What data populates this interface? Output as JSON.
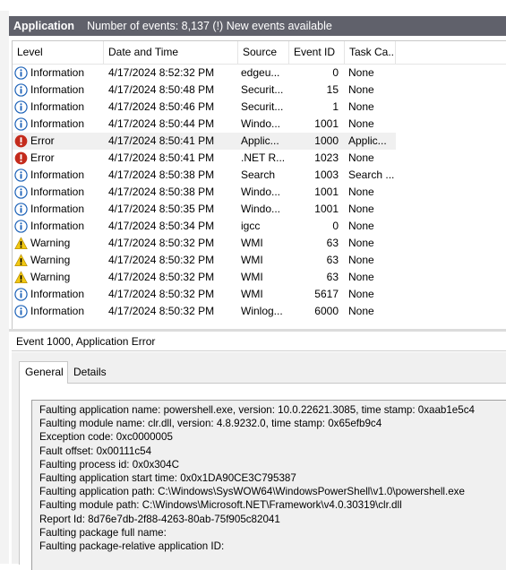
{
  "header": {
    "log_name": "Application",
    "info": "Number of events: 8,137 (!) New events available"
  },
  "columns": [
    "Level",
    "Date and Time",
    "Source",
    "Event ID",
    "Task Ca..."
  ],
  "events": [
    {
      "level": "Information",
      "icon": "info-icon",
      "date": "4/17/2024 8:52:32 PM",
      "source": "edgeu...",
      "event_id": "0",
      "task": "None"
    },
    {
      "level": "Information",
      "icon": "info-icon",
      "date": "4/17/2024 8:50:48 PM",
      "source": "Securit...",
      "event_id": "15",
      "task": "None"
    },
    {
      "level": "Information",
      "icon": "info-icon",
      "date": "4/17/2024 8:50:46 PM",
      "source": "Securit...",
      "event_id": "1",
      "task": "None"
    },
    {
      "level": "Information",
      "icon": "info-icon",
      "date": "4/17/2024 8:50:44 PM",
      "source": "Windo...",
      "event_id": "1001",
      "task": "None"
    },
    {
      "level": "Error",
      "icon": "error-icon",
      "date": "4/17/2024 8:50:41 PM",
      "source": "Applic...",
      "event_id": "1000",
      "task": "Applic...",
      "selected": true
    },
    {
      "level": "Error",
      "icon": "error-icon",
      "date": "4/17/2024 8:50:41 PM",
      "source": ".NET R...",
      "event_id": "1023",
      "task": "None"
    },
    {
      "level": "Information",
      "icon": "info-icon",
      "date": "4/17/2024 8:50:38 PM",
      "source": "Search",
      "event_id": "1003",
      "task": "Search ..."
    },
    {
      "level": "Information",
      "icon": "info-icon",
      "date": "4/17/2024 8:50:38 PM",
      "source": "Windo...",
      "event_id": "1001",
      "task": "None"
    },
    {
      "level": "Information",
      "icon": "info-icon",
      "date": "4/17/2024 8:50:35 PM",
      "source": "Windo...",
      "event_id": "1001",
      "task": "None"
    },
    {
      "level": "Information",
      "icon": "info-icon",
      "date": "4/17/2024 8:50:34 PM",
      "source": "igcc",
      "event_id": "0",
      "task": "None"
    },
    {
      "level": "Warning",
      "icon": "warning-icon",
      "date": "4/17/2024 8:50:32 PM",
      "source": "WMI",
      "event_id": "63",
      "task": "None"
    },
    {
      "level": "Warning",
      "icon": "warning-icon",
      "date": "4/17/2024 8:50:32 PM",
      "source": "WMI",
      "event_id": "63",
      "task": "None"
    },
    {
      "level": "Warning",
      "icon": "warning-icon",
      "date": "4/17/2024 8:50:32 PM",
      "source": "WMI",
      "event_id": "63",
      "task": "None"
    },
    {
      "level": "Information",
      "icon": "info-icon",
      "date": "4/17/2024 8:50:32 PM",
      "source": "WMI",
      "event_id": "5617",
      "task": "None"
    },
    {
      "level": "Information",
      "icon": "info-icon",
      "date": "4/17/2024 8:50:32 PM",
      "source": "Winlog...",
      "event_id": "6000",
      "task": "None"
    }
  ],
  "detail": {
    "title": "Event 1000, Application Error",
    "tabs": [
      "General",
      "Details"
    ],
    "active_tab": "General",
    "lines": [
      "Faulting application name: powershell.exe, version: 10.0.22621.3085, time stamp: 0xaab1e5c4",
      "Faulting module name: clr.dll, version: 4.8.9232.0, time stamp: 0x65efb9c4",
      "Exception code: 0xc0000005",
      "Fault offset: 0x00111c54",
      "Faulting process id: 0x0x304C",
      "Faulting application start time: 0x0x1DA90CE3C795387",
      "Faulting application path: C:\\Windows\\SysWOW64\\WindowsPowerShell\\v1.0\\powershell.exe",
      "Faulting module path: C:\\Windows\\Microsoft.NET\\Framework\\v4.0.30319\\clr.dll",
      "Report Id: 8d76e7db-2f88-4263-80ab-75f905c82041",
      "Faulting package full name: ",
      "Faulting package-relative application ID: "
    ]
  },
  "colors": {
    "title_bar": "#60616b",
    "info": "#1e63b8",
    "error": "#c42b1c",
    "warning": "#f2c811"
  }
}
